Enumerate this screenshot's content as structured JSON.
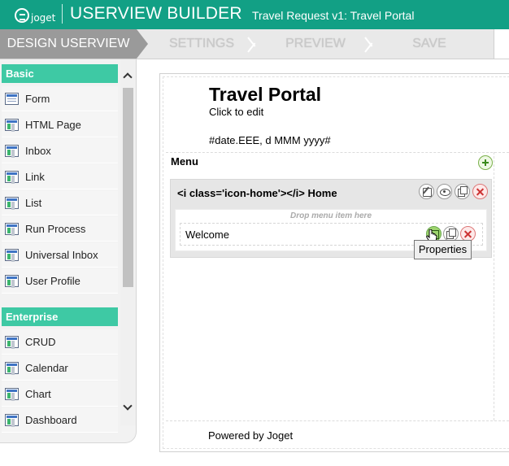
{
  "header": {
    "logo_text": "joget",
    "title": "USERVIEW BUILDER",
    "subtitle": "Travel Request v1: Travel Portal",
    "background_color": "#12a085"
  },
  "tabs": [
    {
      "label": "DESIGN USERVIEW",
      "active": true
    },
    {
      "label": "SETTINGS",
      "active": false
    },
    {
      "label": "PREVIEW",
      "active": false
    },
    {
      "label": "SAVE",
      "active": false
    }
  ],
  "sidebar": {
    "accent_color": "#3ec9a4",
    "sections": [
      {
        "title": "Basic",
        "items": [
          {
            "label": "Form",
            "icon": "form-icon"
          },
          {
            "label": "HTML Page",
            "icon": "html-page-icon"
          },
          {
            "label": "Inbox",
            "icon": "inbox-icon"
          },
          {
            "label": "Link",
            "icon": "link-icon"
          },
          {
            "label": "List",
            "icon": "list-icon"
          },
          {
            "label": "Run Process",
            "icon": "run-process-icon"
          },
          {
            "label": "Universal Inbox",
            "icon": "universal-inbox-icon"
          },
          {
            "label": "User Profile",
            "icon": "user-profile-icon"
          }
        ]
      },
      {
        "title": "Enterprise",
        "items": [
          {
            "label": "CRUD",
            "icon": "crud-icon"
          },
          {
            "label": "Calendar",
            "icon": "calendar-icon"
          },
          {
            "label": "Chart",
            "icon": "chart-icon"
          },
          {
            "label": "Dashboard",
            "icon": "dashboard-icon"
          }
        ]
      }
    ]
  },
  "canvas": {
    "title": "Travel Portal",
    "description": "Click to edit",
    "date_format": "#date.EEE, d MMM yyyy#",
    "menu_label": "Menu",
    "category": {
      "label": "<i class='icon-home'></i> Home",
      "drop_hint": "Drop menu item here",
      "items": [
        {
          "label": "Welcome"
        }
      ]
    },
    "footer": "Powered by Joget"
  },
  "tooltip": {
    "text": "Properties"
  }
}
